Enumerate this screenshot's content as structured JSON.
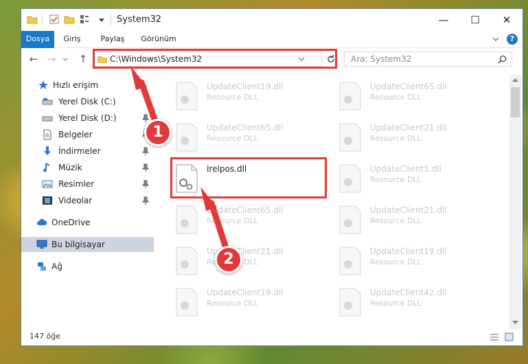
{
  "window": {
    "title": "System32"
  },
  "ribbon": {
    "tabs": [
      "Dosya",
      "Giriş",
      "Paylaş",
      "Görünüm"
    ],
    "help": "?"
  },
  "address": {
    "path": "C:\\Windows\\System32",
    "search_placeholder": "Ara: System32"
  },
  "sidebar": {
    "items": [
      {
        "label": "Hızlı erişim",
        "icon": "star-icon"
      },
      {
        "label": "Yerel Disk (C:)",
        "icon": "drive-icon"
      },
      {
        "label": "Yerel Disk (D:)",
        "icon": "drive-icon"
      },
      {
        "label": "Belgeler",
        "icon": "document-icon"
      },
      {
        "label": "İndirmeler",
        "icon": "download-icon"
      },
      {
        "label": "Müzik",
        "icon": "music-icon"
      },
      {
        "label": "Resimler",
        "icon": "picture-icon"
      },
      {
        "label": "Videolar",
        "icon": "video-icon"
      },
      {
        "label": "OneDrive",
        "icon": "cloud-icon"
      },
      {
        "label": "Bu bilgisayar",
        "icon": "computer-icon"
      },
      {
        "label": "Ağ",
        "icon": "network-icon"
      }
    ]
  },
  "files": [
    {
      "name": "UpdateClient19.dll",
      "type": "Resource DLL"
    },
    {
      "name": "UpdateClient65.dll",
      "type": "Resource DLL"
    },
    {
      "name": "UpdateClient65.dll",
      "type": "Resource DLL"
    },
    {
      "name": "UpdateClient21.dll",
      "type": "Resource DLL"
    },
    {
      "name": "Irelpos.dll",
      "type": ""
    },
    {
      "name": "UpdateClient5.dll",
      "type": "Resource DLL"
    },
    {
      "name": "UpdateClient65.dll",
      "type": "Resource DLL"
    },
    {
      "name": "UpdateClient21.dll",
      "type": "Resource DLL"
    },
    {
      "name": "UpdateClient21.dll",
      "type": "Resource DLL"
    },
    {
      "name": "UpdateClient19.dll",
      "type": "Resource DLL"
    },
    {
      "name": "UpdateClient19.dll",
      "type": "Resource DLL"
    },
    {
      "name": "UpdateClient42.dll",
      "type": "Resource DLL"
    }
  ],
  "status": {
    "count": "147 öğe"
  },
  "callouts": [
    "1",
    "2"
  ],
  "colors": {
    "accent": "#1979ca",
    "highlight": "#e2393b",
    "selected": "#ccd5e0"
  }
}
